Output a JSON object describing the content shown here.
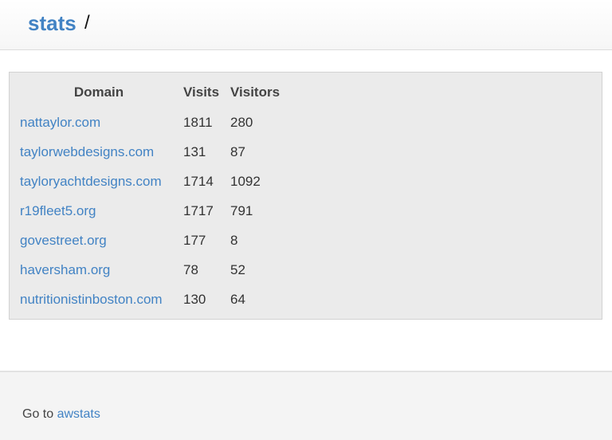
{
  "header": {
    "brand": "stats",
    "separator": "/"
  },
  "table": {
    "columns": [
      "Domain",
      "Visits",
      "Visitors"
    ],
    "rows": [
      {
        "domain": "nattaylor.com",
        "visits": "1811",
        "visitors": "280"
      },
      {
        "domain": "taylorwebdesigns.com",
        "visits": "131",
        "visitors": "87"
      },
      {
        "domain": "tayloryachtdesigns.com",
        "visits": "1714",
        "visitors": "1092"
      },
      {
        "domain": "r19fleet5.org",
        "visits": "1717",
        "visitors": "791"
      },
      {
        "domain": "govestreet.org",
        "visits": "177",
        "visitors": "8"
      },
      {
        "domain": "haversham.org",
        "visits": "78",
        "visitors": "52"
      },
      {
        "domain": "nutritionistinboston.com",
        "visits": "130",
        "visitors": "64"
      }
    ]
  },
  "footer": {
    "prefix": "Go to ",
    "link_label": "awstats"
  },
  "colors": {
    "link": "#4283c4",
    "well_background": "#ebebeb",
    "footer_background": "#f4f4f4"
  }
}
